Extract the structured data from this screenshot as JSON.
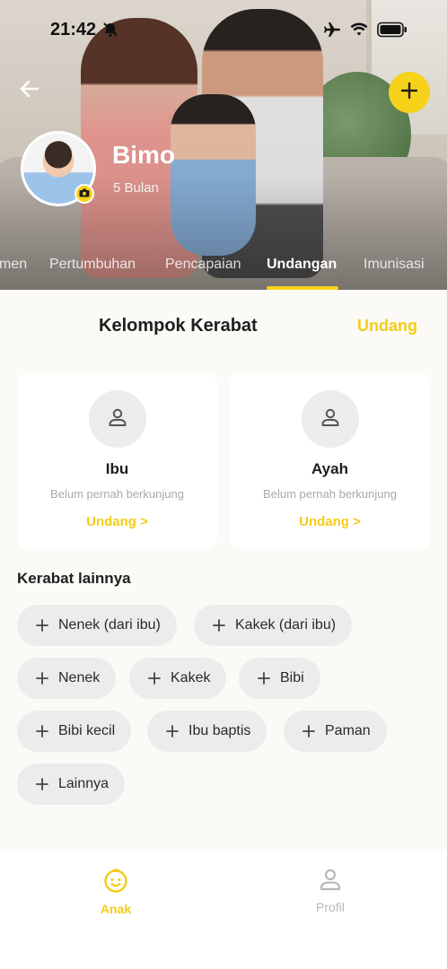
{
  "status_bar": {
    "time": "21:42"
  },
  "header": {
    "child_name": "Bimo",
    "child_age": "5 Bulan",
    "tabs": [
      "men",
      "Pertumbuhan",
      "Pencapaian",
      "Undangan",
      "Imunisasi"
    ],
    "active_tab": "Undangan"
  },
  "section": {
    "title": "Kelompok Kerabat",
    "invite_label": "Undang"
  },
  "cards": [
    {
      "label": "Ibu",
      "status": "Belum pernah berkunjung",
      "action": "Undang >"
    },
    {
      "label": "Ayah",
      "status": "Belum pernah berkunjung",
      "action": "Undang >"
    }
  ],
  "other": {
    "title": "Kerabat lainnya",
    "chips": [
      "Nenek (dari ibu)",
      "Kakek (dari ibu)",
      "Nenek",
      "Kakek",
      "Bibi",
      "Bibi kecil",
      "Ibu baptis",
      "Paman",
      "Lainnya"
    ]
  },
  "bottom_nav": {
    "items": [
      {
        "label": "Anak",
        "icon": "baby-face-icon"
      },
      {
        "label": "Profil",
        "icon": "person-icon"
      }
    ],
    "active": "Anak"
  },
  "colors": {
    "accent": "#f4cc1a",
    "background": "#fbfaf6"
  }
}
